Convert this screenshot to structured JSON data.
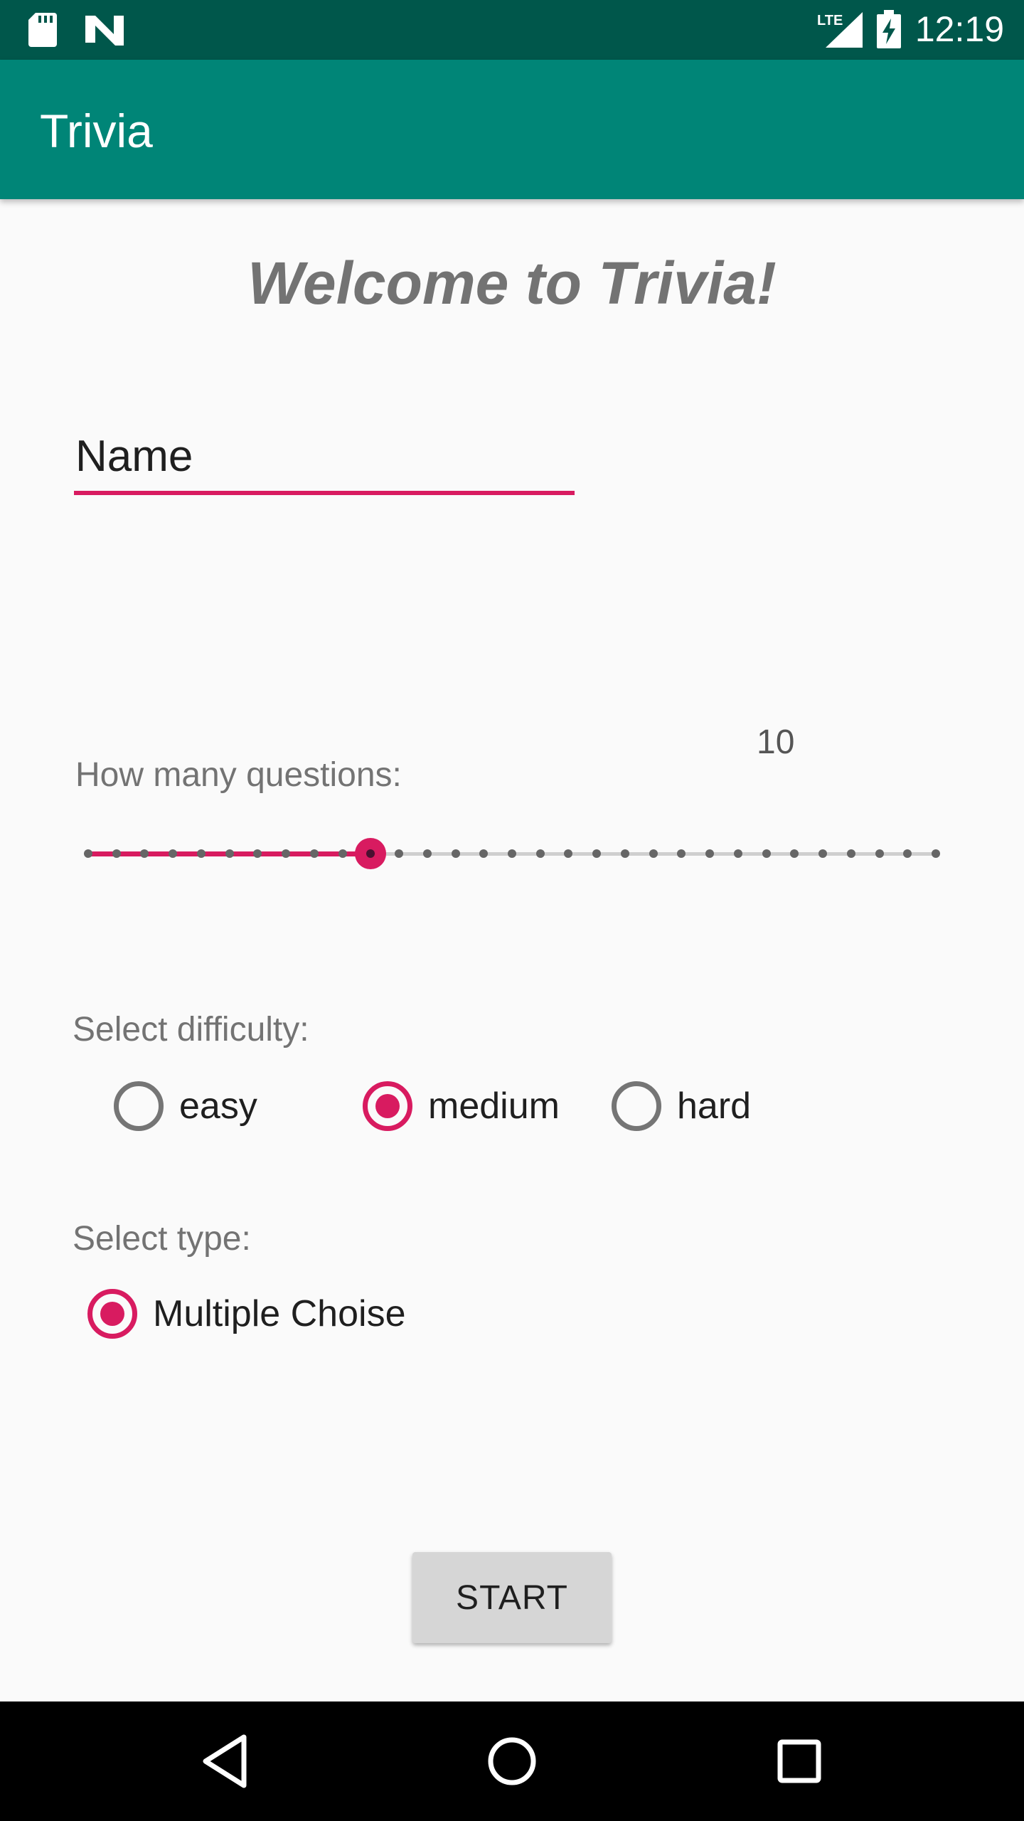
{
  "status_bar": {
    "time": "12:19",
    "network": "LTE",
    "icons": [
      "sd-card-icon",
      "n-icon",
      "lte-signal-icon",
      "battery-charging-icon"
    ]
  },
  "app_bar": {
    "title": "Trivia"
  },
  "welcome": "Welcome to Trivia!",
  "name_field": {
    "placeholder": "Name",
    "value": ""
  },
  "questions": {
    "label": "How many questions:",
    "value": "10",
    "slider_min": 0,
    "slider_max": 30,
    "slider_value": 10
  },
  "difficulty": {
    "label": "Select difficulty:",
    "options": [
      "easy",
      "medium",
      "hard"
    ],
    "selected": "medium"
  },
  "type": {
    "label": "Select type:",
    "options": [
      "Multiple Choise"
    ],
    "selected": "Multiple Choise"
  },
  "start_button": "START",
  "nav_bar": {
    "buttons": [
      "back-icon",
      "home-icon",
      "recents-icon"
    ]
  },
  "colors": {
    "status_bar": "#00574b",
    "app_bar": "#008577",
    "accent": "#d81b60",
    "background": "#fafafa"
  }
}
